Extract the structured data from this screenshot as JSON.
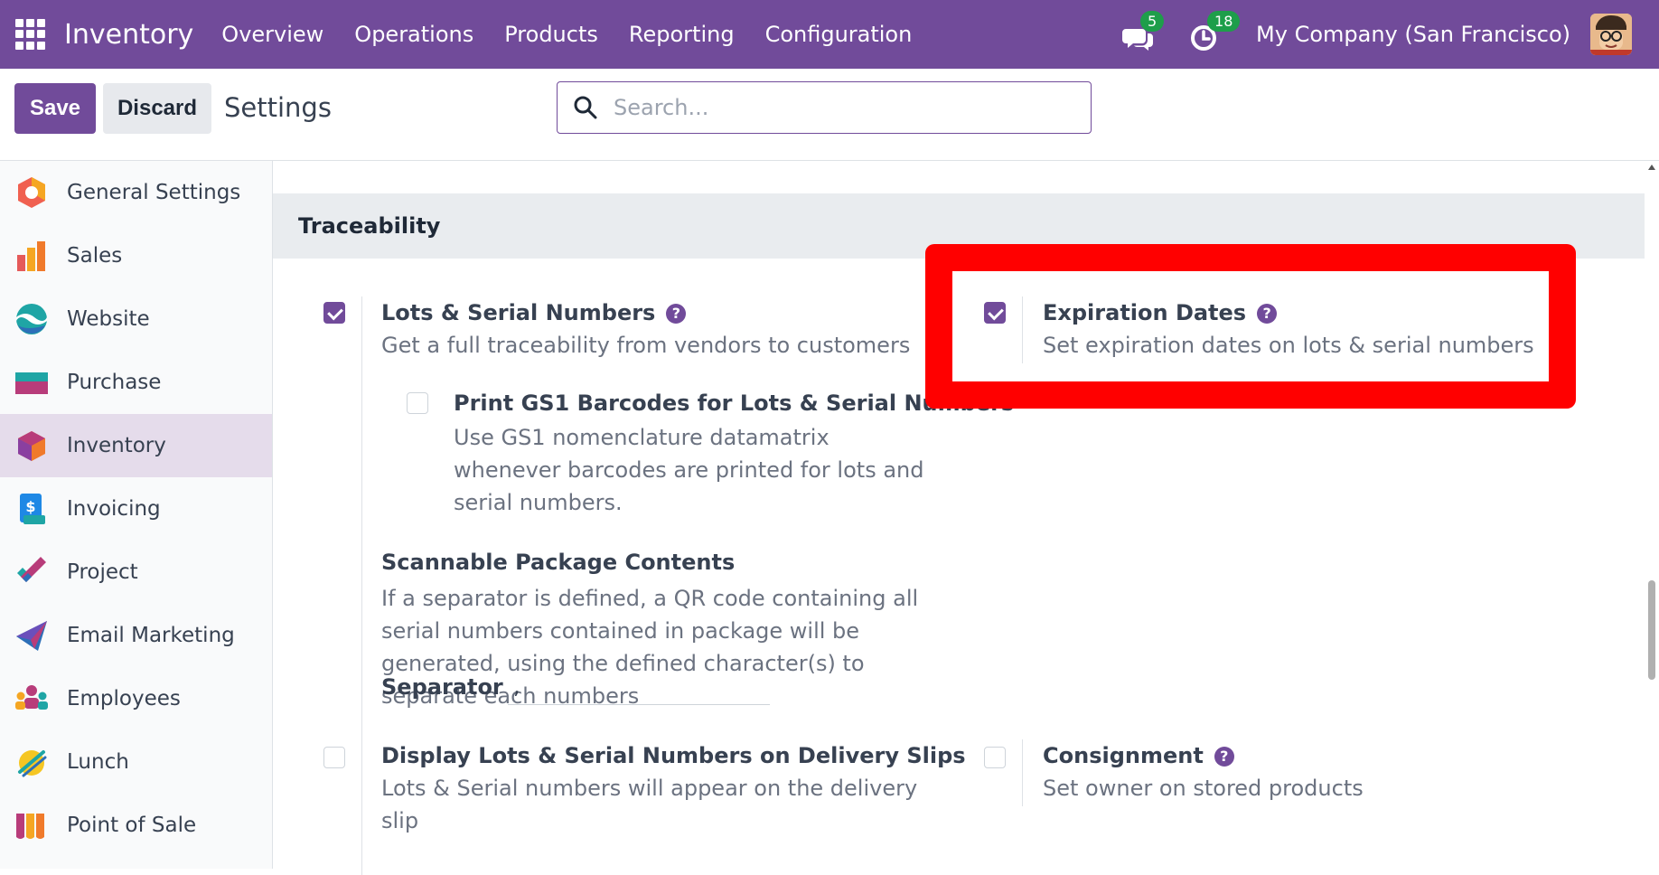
{
  "navbar": {
    "brand": "Inventory",
    "menu": [
      "Overview",
      "Operations",
      "Products",
      "Reporting",
      "Configuration"
    ],
    "messages_count": "5",
    "activities_count": "18",
    "company": "My Company (San Francisco)",
    "color": "#714B9A"
  },
  "control": {
    "save_label": "Save",
    "discard_label": "Discard",
    "title": "Settings",
    "search_placeholder": "Search..."
  },
  "sidebar": {
    "items": [
      {
        "label": "General Settings",
        "icon": "general-settings-icon"
      },
      {
        "label": "Sales",
        "icon": "sales-icon"
      },
      {
        "label": "Website",
        "icon": "website-icon"
      },
      {
        "label": "Purchase",
        "icon": "purchase-icon"
      },
      {
        "label": "Inventory",
        "icon": "inventory-icon",
        "active": true
      },
      {
        "label": "Invoicing",
        "icon": "invoicing-icon"
      },
      {
        "label": "Project",
        "icon": "project-icon"
      },
      {
        "label": "Email Marketing",
        "icon": "email-marketing-icon"
      },
      {
        "label": "Employees",
        "icon": "employees-icon"
      },
      {
        "label": "Lunch",
        "icon": "lunch-icon"
      },
      {
        "label": "Point of Sale",
        "icon": "point-of-sale-icon"
      }
    ]
  },
  "section": {
    "title": "Traceability",
    "lots": {
      "title": "Lots & Serial Numbers",
      "desc": "Get a full traceability from vendors to customers",
      "checked": true
    },
    "expiration": {
      "title": "Expiration Dates",
      "desc": "Set expiration dates on lots & serial numbers",
      "checked": true
    },
    "gs1": {
      "title": "Print GS1 Barcodes for Lots & Serial Numbers",
      "desc": "Use GS1 nomenclature datamatrix whenever barcodes are printed for lots and serial numbers.",
      "checked": false
    },
    "scannable": {
      "title": "Scannable Package Contents",
      "desc": "If a separator is defined, a QR code containing all serial numbers contained in package will be generated, using the defined character(s) to separate each numbers",
      "separator_label": "Separator",
      "separator_value": ","
    },
    "delivery": {
      "title": "Display Lots & Serial Numbers on Delivery Slips",
      "desc": "Lots & Serial numbers will appear on the delivery slip",
      "checked": false
    },
    "consignment": {
      "title": "Consignment",
      "desc": "Set owner on stored products",
      "checked": false
    }
  },
  "help_glyph": "?",
  "highlight_color": "#FF0000"
}
